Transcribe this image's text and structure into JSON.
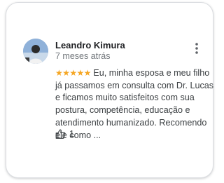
{
  "review": {
    "author": "Leandro Kimura",
    "date": "7 meses atrás",
    "rating": 5,
    "stars": "★★★★★",
    "text": "Eu, minha esposa e meu filho já passamos em consulta com Dr. Lucas e ficamos muito satisfeitos com sua postura, competência, educação e atendimento humanizado. Recomendo ele como ...",
    "likes": "1"
  },
  "colors": {
    "star": "#f5a623",
    "name": "#202124",
    "muted": "#70757a",
    "body": "#3c4043",
    "border": "#dadce0"
  },
  "icons": {
    "more": "more-vert-icon",
    "like": "thumb-up-icon"
  }
}
